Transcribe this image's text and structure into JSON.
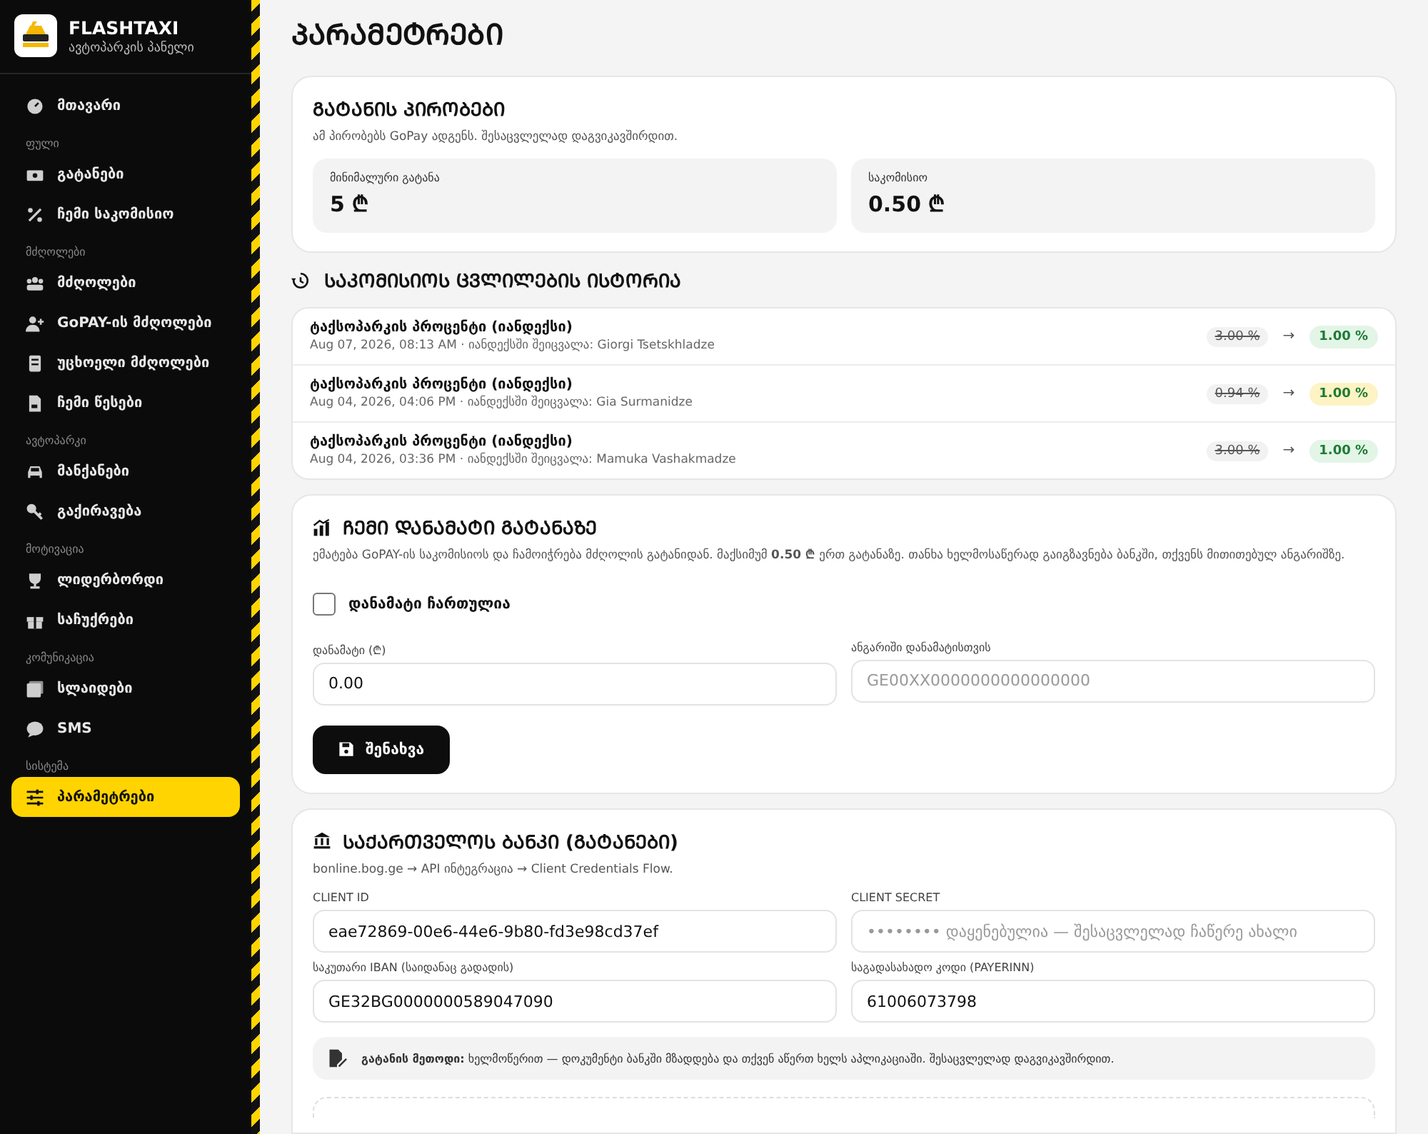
{
  "brand": {
    "name": "FLASHTAXI",
    "subtitle": "ავტოპარკის პანელი"
  },
  "sidebar": {
    "items": [
      {
        "kind": "link",
        "label": "მთავარი",
        "selected": false
      },
      {
        "kind": "section",
        "label": "ფული"
      },
      {
        "kind": "link",
        "label": "გატანები",
        "selected": false
      },
      {
        "kind": "link",
        "label": "ჩემი საკომისიო",
        "selected": false
      },
      {
        "kind": "section",
        "label": "მძღოლები"
      },
      {
        "kind": "link",
        "label": "მძღოლები",
        "selected": false
      },
      {
        "kind": "link",
        "label": "GoPAY-ის მძღოლები",
        "selected": false
      },
      {
        "kind": "link",
        "label": "უცხოელი მძღოლები",
        "selected": false
      },
      {
        "kind": "link",
        "label": "ჩემი წესები",
        "selected": false
      },
      {
        "kind": "section",
        "label": "ავტოპარკი"
      },
      {
        "kind": "link",
        "label": "მანქანები",
        "selected": false
      },
      {
        "kind": "link",
        "label": "გაქირავება",
        "selected": false
      },
      {
        "kind": "section",
        "label": "მოტივაცია"
      },
      {
        "kind": "link",
        "label": "ლიდერბორდი",
        "selected": false
      },
      {
        "kind": "link",
        "label": "საჩუქრები",
        "selected": false
      },
      {
        "kind": "section",
        "label": "კომუნიკაცია"
      },
      {
        "kind": "link",
        "label": "სლაიდები",
        "selected": false
      },
      {
        "kind": "link",
        "label": "SMS",
        "selected": false
      },
      {
        "kind": "section",
        "label": "სისტემა"
      },
      {
        "kind": "link",
        "label": "პარამეტრები",
        "selected": true
      }
    ]
  },
  "page_title": "ᲞᲐᲠᲐᲛᲔᲢᲠᲔᲑᲘ",
  "terms": {
    "title": "ᲒᲐᲢᲐᲜᲘᲡ ᲞᲘᲠᲝᲑᲔᲑᲘ",
    "description": "ამ პირობებს GoPay ადგენს. შესაცვლელად დაგვიკავშირდით.",
    "stats": [
      {
        "label": "მინიმალური გატანა",
        "value": "5 ₾"
      },
      {
        "label": "საკომისიო",
        "value": "0.50 ₾"
      }
    ]
  },
  "history": {
    "title": "ᲡᲐᲙᲝᲛᲘᲡᲘᲝᲡ ᲪᲕᲚᲘᲚᲔᲑᲘᲡ ᲘᲡᲢᲝᲠᲘᲐ",
    "rows": [
      {
        "title": "ტაქსოპარკის პროცენტი (იანდექსი)",
        "meta": "Aug 07, 2026, 08:13 AM · იანდექსში შეიცვალა: Giorgi Tsetskhladze",
        "old": "3.00 %",
        "arrow": "→",
        "new": "1.00 %",
        "color": "#e3f5e6"
      },
      {
        "title": "ტაქსოპარკის პროცენტი (იანდექსი)",
        "meta": "Aug 04, 2026, 04:06 PM · იანდექსში შეიცვალა: Gia Surmanidze",
        "old": "0.94 %",
        "arrow": "→",
        "new": "1.00 %",
        "color": "#fdf3c4"
      },
      {
        "title": "ტაქსოპარკის პროცენტი (იანდექსი)",
        "meta": "Aug 04, 2026, 03:36 PM · იანდექსში შეიცვალა: Mamuka Vashakmadze",
        "old": "3.00 %",
        "arrow": "→",
        "new": "1.00 %",
        "color": "#e3f5e6"
      }
    ]
  },
  "surcharge": {
    "title": "ᲩᲔᲛᲘ ᲓᲐᲜᲐᲛᲐᲢᲘ ᲒᲐᲢᲐᲜᲐᲖᲔ",
    "description": "ემატება GoPAY-ის საკომისიოს და ჩამოიჭრება მძღოლის გატანიდან. მაქსიმუმ **0.50 ₾** ერთ გატანაზე. თანხა ხელმოსაწერად გაიგზავნება ბანკში, თქვენს მითითებულ ანგარიშზე.",
    "checkbox": {
      "label": "დანამატი ჩართულია",
      "checked": false
    },
    "fields": [
      {
        "label": "დანამატი (₾)",
        "value": "0.00"
      },
      {
        "label": "ანგარიში დანამატისთვის",
        "placeholder": "GE00XX0000000000000000"
      }
    ],
    "button": "შენახვა"
  },
  "bank": {
    "title": "ᲡᲐᲥᲐᲠᲗᲕᲔᲚᲝᲡ ᲑᲐᲜᲙᲘ (ᲒᲐᲢᲐᲜᲔᲑᲘ)",
    "description": "bonline.bog.ge → API ინტეგრაცია → Client Credentials Flow.",
    "fields": [
      {
        "label": "CLIENT ID",
        "value": "eae72869-00e6-44e6-9b80-fd3e98cd37ef"
      },
      {
        "label": "CLIENT SECRET",
        "placeholder": "•••••••• დაყენებულია — შესაცვლელად ჩაწერე ახალი"
      },
      {
        "label": "საკუთარი IBAN (საიდანაც გადადის)",
        "value": "GE32BG0000000589047090"
      },
      {
        "label": "საგადასახადო კოდი (PAYERINN)",
        "value": "61006073798"
      }
    ],
    "note": "**გატანის მეთოდი:** ხელმოწერით — დოკუმენტი ბანკში მზადდება და თქვენ აწერთ ხელს აპლიკაციაში. შესაცვლელად დაგვიკავშირდით."
  }
}
